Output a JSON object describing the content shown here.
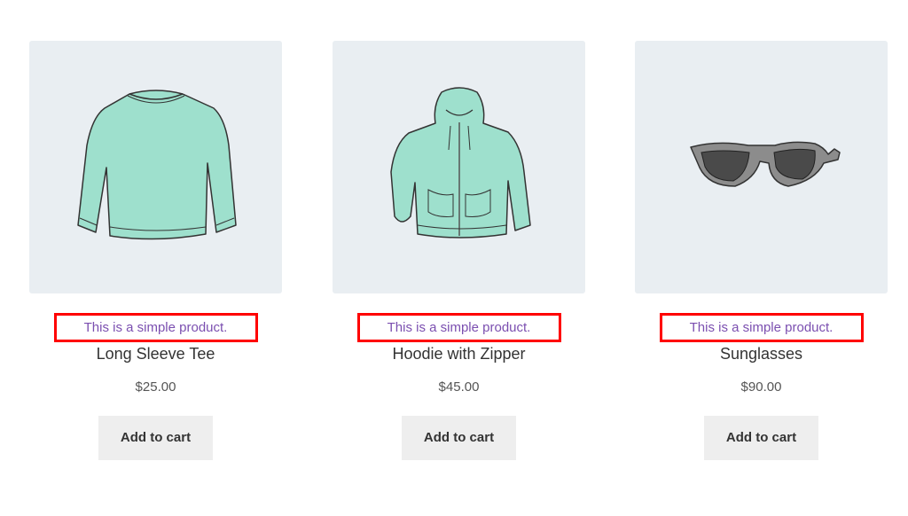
{
  "colors": {
    "thumb_bg": "#e9eef2",
    "description": "#7b4fb0",
    "highlight_border": "#ff0000",
    "button_bg": "#eeeeee",
    "garment": "#9ee0cd"
  },
  "products": [
    {
      "image_icon": "long-sleeve-tee-image",
      "description": "This is a simple product.",
      "title": "Long Sleeve Tee",
      "price": "$25.00",
      "button_label": "Add to cart"
    },
    {
      "image_icon": "hoodie-image",
      "description": "This is a simple product.",
      "title": "Hoodie with Zipper",
      "price": "$45.00",
      "button_label": "Add to cart"
    },
    {
      "image_icon": "sunglasses-image",
      "description": "This is a simple product.",
      "title": "Sunglasses",
      "price": "$90.00",
      "button_label": "Add to cart"
    }
  ]
}
